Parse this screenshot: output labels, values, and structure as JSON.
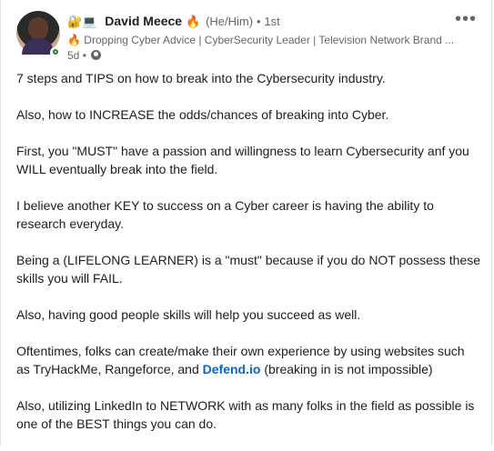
{
  "post": {
    "author": {
      "badge_emojis": "🔐💻",
      "name": "David Meece",
      "name_emoji": "🔥",
      "pronouns": "(He/Him)",
      "connection_sep": "•",
      "degree": "1st",
      "headline": "🔥 Dropping Cyber Advice | CyberSecurity Leader | Television Network Brand ...",
      "time": "5d",
      "meta_sep": "•",
      "visibility_icon": "globe-icon"
    },
    "more_label": "•••",
    "paragraphs": {
      "p1": "7 steps and TIPS on how to break into the Cybersecurity industry.",
      "p2": "Also, how to INCREASE the odds/chances of breaking into Cyber.",
      "p3": "First, you \"MUST\" have a passion and willingness to learn Cybersecurity anf you WILL eventually break into the field.",
      "p4": "I believe another KEY to success on a Cyber career is having the ability to research everyday.",
      "p5": "Being a (LIFELONG LEARNER) is a \"must\" because if you do NOT possess these skills you will FAIL.",
      "p6": "Also, having good people skills will help you succeed as well.",
      "p7_before": "Oftentimes, folks can create/make their own experience by using websites such as TryHackMe, Rangeforce, and ",
      "p7_link": "Defend.io",
      "p7_after": " (breaking in is not impossible)",
      "p8": "Also, utilizing LinkedIn to NETWORK with as many folks in the field as possible is one of the BEST things you can do."
    }
  },
  "colors": {
    "link": "#0a66c2",
    "presence": "#2e7d32",
    "muted": "#666666"
  }
}
